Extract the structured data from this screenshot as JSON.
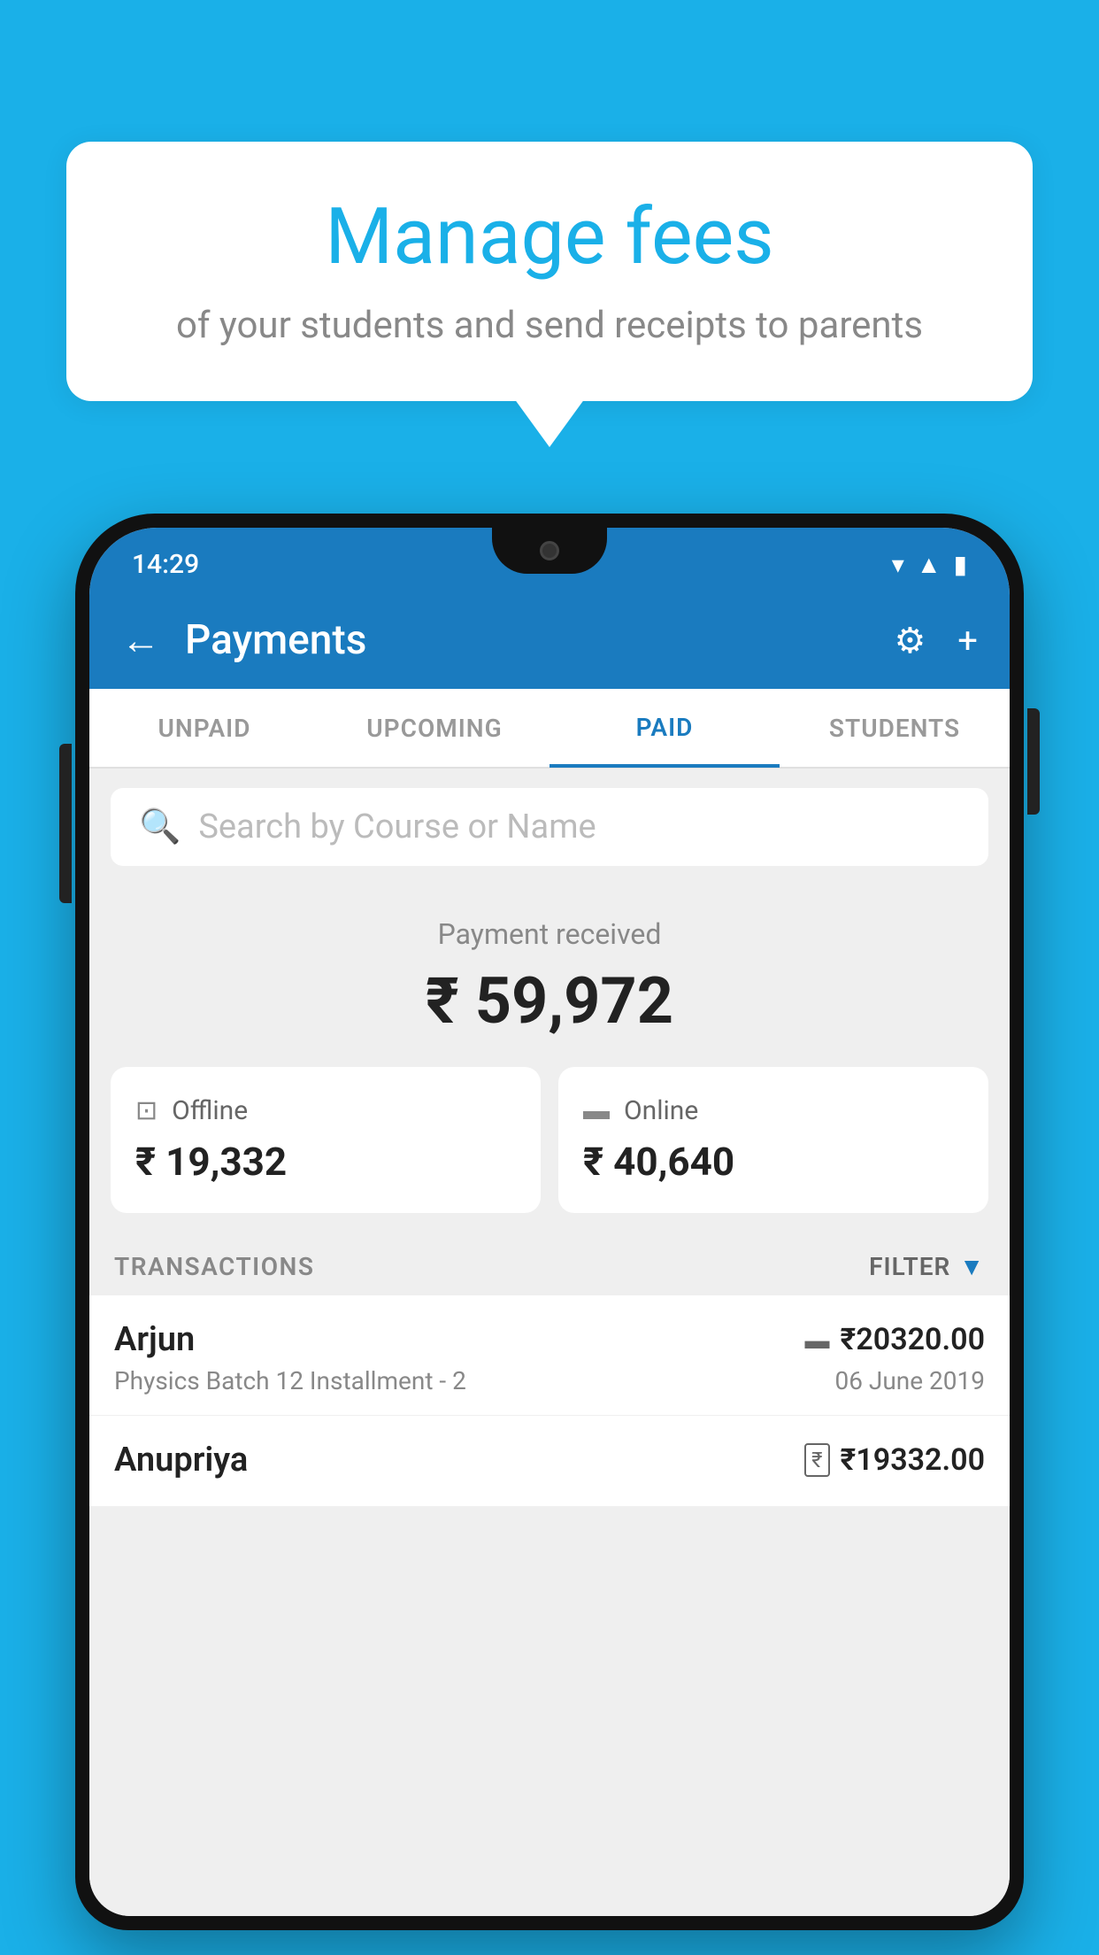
{
  "background": {
    "color": "#1ab0e8"
  },
  "speech_bubble": {
    "title": "Manage fees",
    "subtitle": "of your students and send receipts to parents"
  },
  "status_bar": {
    "time": "14:29",
    "wifi_icon": "▾",
    "signal_icon": "▲",
    "battery_icon": "▮"
  },
  "app_bar": {
    "back_label": "←",
    "title": "Payments",
    "settings_icon": "⚙",
    "add_icon": "+"
  },
  "tabs": [
    {
      "label": "UNPAID",
      "active": false
    },
    {
      "label": "UPCOMING",
      "active": false
    },
    {
      "label": "PAID",
      "active": true
    },
    {
      "label": "STUDENTS",
      "active": false
    }
  ],
  "search": {
    "placeholder": "Search by Course or Name",
    "icon": "🔍"
  },
  "payment_summary": {
    "label": "Payment received",
    "amount": "₹ 59,972",
    "offline_label": "Offline",
    "offline_amount": "₹ 19,332",
    "online_label": "Online",
    "online_amount": "₹ 40,640"
  },
  "transactions": {
    "header_label": "TRANSACTIONS",
    "filter_label": "FILTER",
    "items": [
      {
        "name": "Arjun",
        "course": "Physics Batch 12 Installment - 2",
        "amount": "₹20320.00",
        "date": "06 June 2019",
        "payment_type": "card"
      },
      {
        "name": "Anupriya",
        "course": "",
        "amount": "₹19332.00",
        "date": "",
        "payment_type": "cash"
      }
    ]
  }
}
